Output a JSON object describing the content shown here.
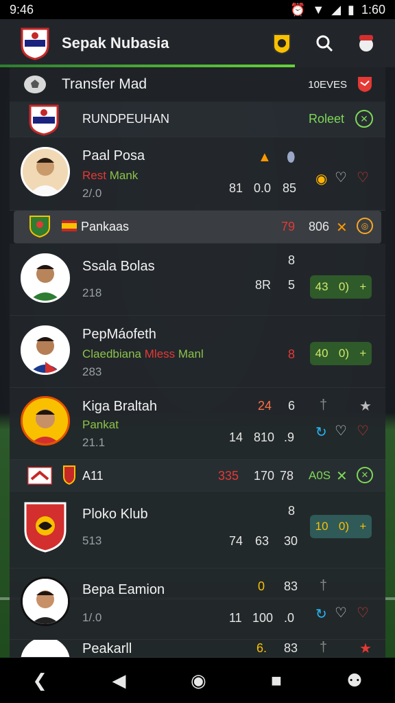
{
  "status_bar": {
    "time": "9:46",
    "clock_right": "1:60"
  },
  "app_bar": {
    "title": "Sepak Nubasia"
  },
  "sub_header": {
    "title": "Transfer  Mad",
    "meta": "10EVES"
  },
  "group1": {
    "name": "RUNDPEUHAN",
    "action": "Roleet"
  },
  "players": [
    {
      "name": "Paal Posa",
      "club_a": "Rest",
      "club_b": "Mank",
      "age": "2/.0",
      "s1": "81",
      "s2": "0.0",
      "s3": "85"
    },
    {
      "name": "Ssala Bolas",
      "age": "218",
      "top": "8",
      "s1": "8R",
      "s2": "5",
      "pill_a": "43",
      "pill_b": "0)",
      "pill_c": "+"
    },
    {
      "name": "PepMáofeth",
      "club_a": "Claedbiana",
      "club_b": "Mless",
      "club_c": "Manl",
      "age": "283",
      "top": "8",
      "pill_a": "40",
      "pill_b": "0)",
      "pill_c": "+"
    },
    {
      "name": "Kiga Braltah",
      "club_a": "Pankat",
      "age": "21.1",
      "top_a": "24",
      "top_b": "6",
      "s1": "14",
      "s2": "810",
      "s3": ".9"
    },
    {
      "name": "Ploko Klub",
      "age": "513",
      "top": "8",
      "s1": "74",
      "s2": "63",
      "s3": "30",
      "pill_a": "10",
      "pill_b": "0)",
      "pill_c": "+"
    },
    {
      "name": "Bepa Eamion",
      "age": "1/.0",
      "top_a": "0",
      "top_b": "83",
      "s1": "11",
      "s2": "100",
      "s3": ".0"
    },
    {
      "name": "Peakarll",
      "top_a": "6.",
      "top_b": "83"
    }
  ],
  "group2": {
    "name": "Pankaas",
    "s1": "79",
    "s2": "806"
  },
  "group3": {
    "name": "A11",
    "s1": "335",
    "s2": "170",
    "s3": "78",
    "action": "A0S"
  },
  "colors": {
    "accent_green": "#66d23a",
    "red": "#e53935",
    "orange": "#ff9800"
  }
}
